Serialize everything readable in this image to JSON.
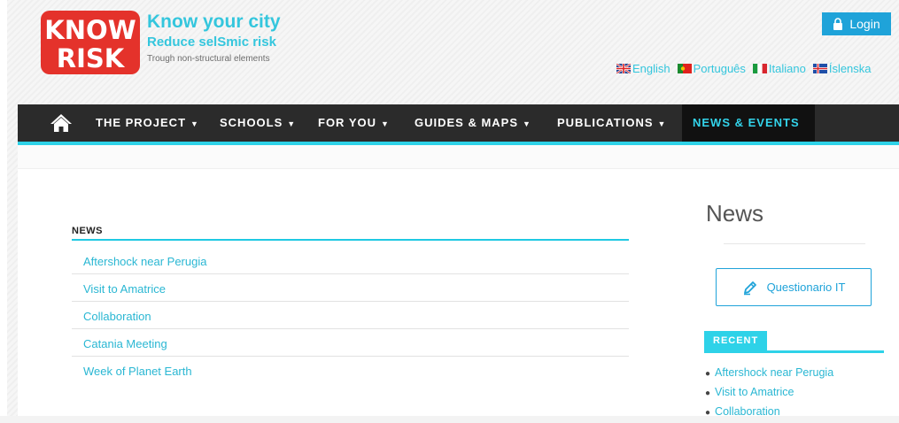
{
  "header": {
    "logo_text_top": "KNOW",
    "logo_text_bottom": "RISK",
    "tagline_main": "Know your city",
    "tagline_sub": "Reduce selSmic risk",
    "tagline_small": "Trough non-structural elements",
    "login_label": "Login",
    "languages": [
      {
        "label": "English",
        "icon": "uk-flag-icon"
      },
      {
        "label": "Português",
        "icon": "portugal-flag-icon"
      },
      {
        "label": "Italiano",
        "icon": "italy-flag-icon"
      },
      {
        "label": "Íslenska",
        "icon": "iceland-flag-icon"
      }
    ]
  },
  "nav": {
    "home_icon": "home-icon",
    "items": [
      {
        "label": "THE PROJECT",
        "caret": "▼"
      },
      {
        "label": "SCHOOLS",
        "caret": "▼"
      },
      {
        "label": "FOR YOU",
        "caret": "▼"
      },
      {
        "label": "GUIDES & MAPS",
        "caret": "▼"
      },
      {
        "label": "PUBLICATIONS",
        "caret": "▼"
      },
      {
        "label": "NEWS & EVENTS",
        "active": true
      }
    ]
  },
  "main": {
    "section_heading": "NEWS",
    "news_items": [
      "Aftershock near Perugia",
      "Visit to Amatrice",
      "Collaboration",
      "Catania Meeting",
      "Week of Planet Earth"
    ]
  },
  "sidebar": {
    "title": "News",
    "questionnaire_label": "Questionario IT",
    "recent_label": "RECENT",
    "recent_items": [
      "Aftershock near Perugia",
      "Visit to Amatrice",
      "Collaboration"
    ]
  },
  "colors": {
    "brand_red": "#e4322b",
    "accent_cyan": "#2ed2e8",
    "link_blue": "#2ab7d3",
    "nav_dark": "#2b2b2b"
  }
}
